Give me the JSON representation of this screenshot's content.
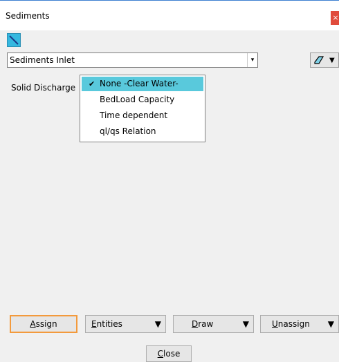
{
  "window": {
    "title": "Sediments",
    "close_glyph": "×"
  },
  "toolbar": {
    "tool_icon": "pencil-icon"
  },
  "inlet_select": {
    "value": "Sediments Inlet",
    "arrow_glyph": "▾"
  },
  "menu_button": {
    "icon": "eraser-icon",
    "caret": "▼"
  },
  "solid_discharge": {
    "label": "Solid Discharge",
    "options": [
      {
        "label": "None  -Clear Water-",
        "selected": true
      },
      {
        "label": "BedLoad Capacity",
        "selected": false
      },
      {
        "label": "Time dependent",
        "selected": false
      },
      {
        "label": "ql/qs Relation",
        "selected": false
      }
    ],
    "check_glyph": "✔"
  },
  "buttons": {
    "assign": {
      "first": "A",
      "rest": "ssign"
    },
    "entities": {
      "first": "E",
      "rest": "ntities",
      "caret": "▼"
    },
    "draw": {
      "first": "D",
      "rest": "raw",
      "caret": "▼"
    },
    "unassign": {
      "first": "U",
      "rest": "nassign",
      "caret": "▼"
    },
    "close": {
      "first": "C",
      "rest": "lose"
    }
  },
  "colors": {
    "accent_focus": "#f39a3c",
    "selection": "#59c9dc",
    "tool_icon_bg": "#35b8e0",
    "close_bg": "#e04b3c"
  }
}
